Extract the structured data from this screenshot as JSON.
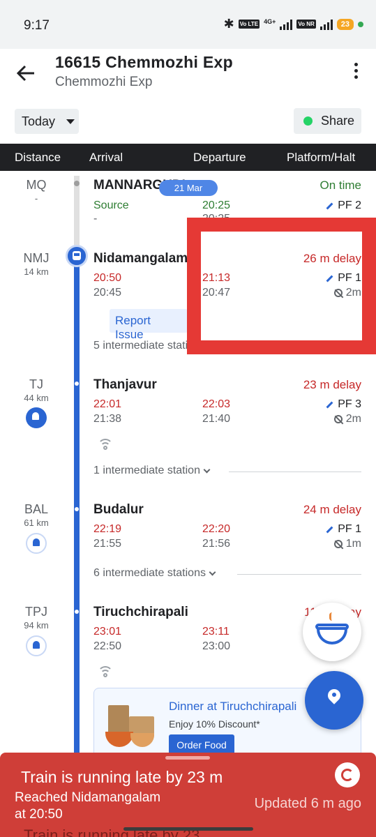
{
  "status_bar": {
    "time": "9:17",
    "tag1": "Vo LTE",
    "network": "4G+",
    "tag2": "Vo NR",
    "battery": "23",
    "icons": [
      "bluetooth-icon",
      "signal-icon",
      "battery-icon"
    ]
  },
  "header": {
    "title": "16615 Chemmozhi Exp",
    "subtitle": "Chemmozhi Exp"
  },
  "toolbar": {
    "date_select": "Today",
    "share_label": "Share"
  },
  "table_header": {
    "distance": "Distance",
    "arrival": "Arrival",
    "departure": "Departure",
    "platform": "Platform/Halt"
  },
  "date_chip": "21 Mar",
  "stations": [
    {
      "code": "MQ",
      "km": "-",
      "name": "MANNARGUDI",
      "status": "On time",
      "arrival_actual": "Source",
      "arrival_sched": "-",
      "departure_actual": "20:25",
      "departure_sched": "20:25",
      "platform": "PF 2"
    },
    {
      "code": "NMJ",
      "km": "14 km",
      "name": "Nidamangalam",
      "status": "26 m delay",
      "arrival_actual": "20:50",
      "arrival_sched": "20:45",
      "departure_actual": "21:13",
      "departure_sched": "20:47",
      "platform": "PF 1",
      "halt": "2m",
      "report": "Report Issue",
      "intermediate": "5 intermediate stations"
    },
    {
      "code": "TJ",
      "km": "44 km",
      "name": "Thanjavur",
      "status": "23 m delay",
      "arrival_actual": "22:01",
      "arrival_sched": "21:38",
      "departure_actual": "22:03",
      "departure_sched": "21:40",
      "platform": "PF 3",
      "halt": "2m",
      "intermediate": "1 intermediate station"
    },
    {
      "code": "BAL",
      "km": "61 km",
      "name": "Budalur",
      "status": "24 m delay",
      "arrival_actual": "22:19",
      "arrival_sched": "21:55",
      "departure_actual": "22:20",
      "departure_sched": "21:56",
      "platform": "PF 1",
      "halt": "1m",
      "intermediate": "6 intermediate stations"
    },
    {
      "code": "TPJ",
      "km": "94 km",
      "name": "Tiruchchirapali",
      "status": "11 m delay",
      "arrival_actual": "23:01",
      "arrival_sched": "22:50",
      "departure_actual": "23:11",
      "departure_sched": "23:00"
    }
  ],
  "food_card": {
    "title": "Dinner at Tiruchchirapali",
    "subtitle": "Enjoy 10% Discount*",
    "button": "Order Food"
  },
  "banner": {
    "title": "Train is running late by 23 m",
    "reached": "Reached Nidamangalam",
    "at": "at 20:50",
    "updated": "Updated 6 m  ago",
    "ghost": "Train is running late by 23"
  },
  "colors": {
    "accent": "#2a65d2",
    "delay": "#c62828",
    "ontime": "#2e7d32",
    "banner": "#cf3e38",
    "highlight": "#e53935"
  }
}
